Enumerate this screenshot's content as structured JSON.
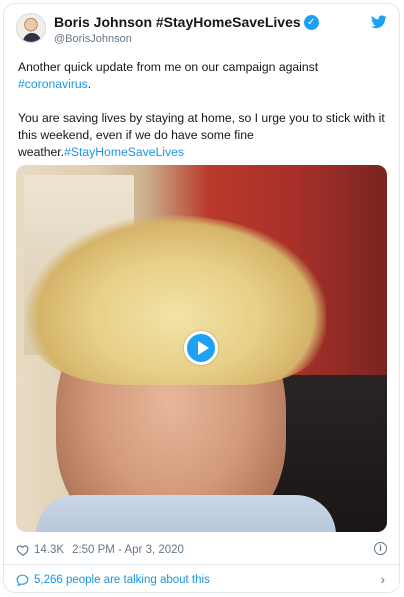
{
  "tweet": {
    "display_name": "Boris Johnson #StayHomeSaveLives",
    "handle": "@BorisJohnson",
    "text_line1": "Another quick update from me on our campaign against",
    "hashtag1": "#coronavirus",
    "text_line1_end": ".",
    "text_para2": "You are saving lives by staying at home, so I urge you to stick with it this weekend, even if we do have some fine weather.",
    "hashtag2": "#StayHomeSaveLives",
    "likes": "14.3K",
    "timestamp": "2:50 PM - Apr 3, 2020",
    "talking": "5,266 people are talking about this"
  },
  "icons": {
    "verified": "verified-badge-icon",
    "bird": "twitter-bird-icon",
    "play": "play-icon",
    "heart": "heart-icon",
    "info": "info-icon",
    "bubble": "comment-bubble-icon",
    "chevron": "chevron-right-icon"
  },
  "colors": {
    "accent": "#1da1f2",
    "link": "#1b95e0",
    "muted": "#657786",
    "text": "#14171a"
  }
}
